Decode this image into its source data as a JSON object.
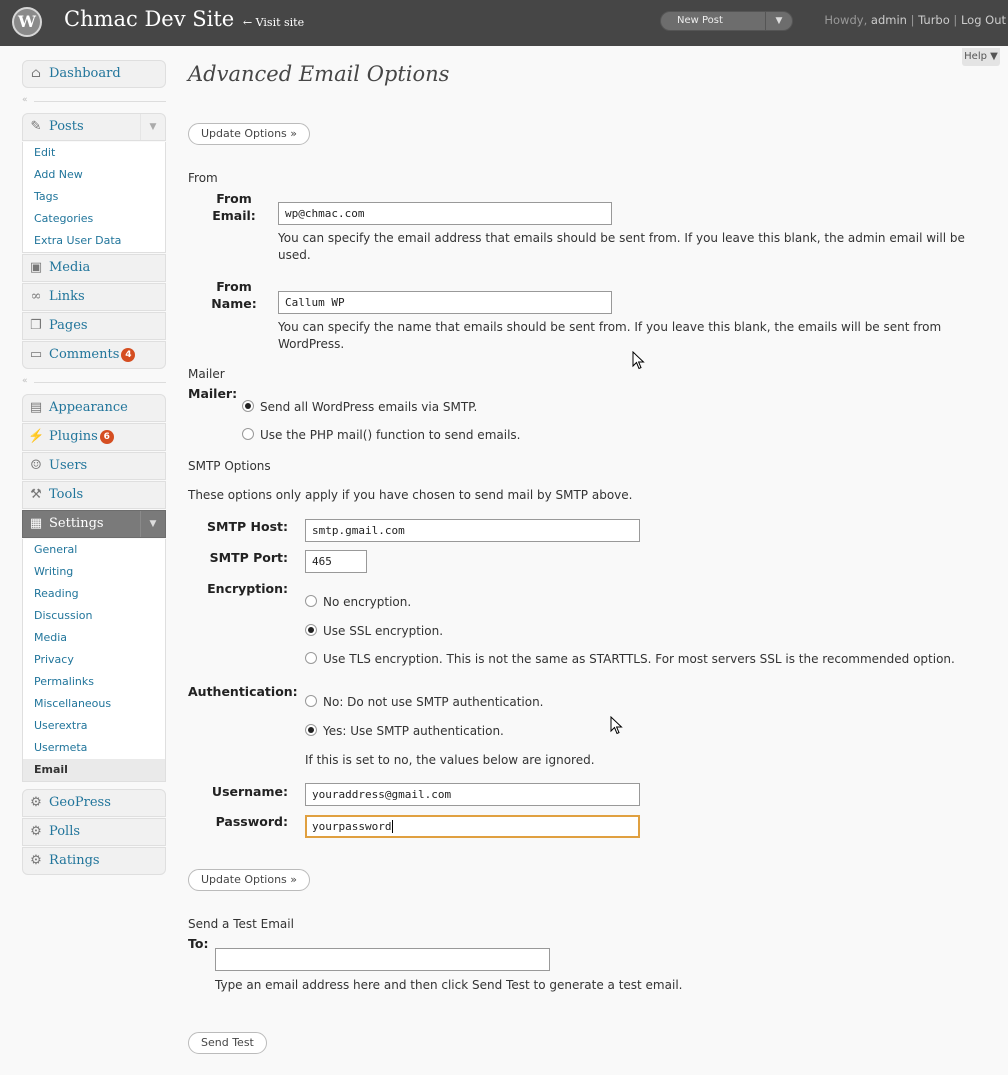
{
  "header": {
    "site_title": "Chmac Dev Site",
    "visit_site": "← Visit site",
    "new_post": "New Post",
    "howdy": "Howdy,",
    "user": "admin",
    "turbo": "Turbo",
    "logout": "Log Out",
    "help": "Help ▼"
  },
  "menu": {
    "dashboard": "Dashboard",
    "posts": "Posts",
    "posts_sub": [
      "Edit",
      "Add New",
      "Tags",
      "Categories",
      "Extra User Data"
    ],
    "media": "Media",
    "links": "Links",
    "pages": "Pages",
    "comments": "Comments",
    "comments_count": "4",
    "appearance": "Appearance",
    "plugins": "Plugins",
    "plugins_count": "6",
    "users": "Users",
    "tools": "Tools",
    "settings": "Settings",
    "settings_sub": [
      "General",
      "Writing",
      "Reading",
      "Discussion",
      "Media",
      "Privacy",
      "Permalinks",
      "Miscellaneous",
      "Userextra",
      "Usermeta",
      "Email"
    ],
    "geopress": "GeoPress",
    "polls": "Polls",
    "ratings": "Ratings"
  },
  "page": {
    "title": "Advanced Email Options",
    "update_button": "Update Options »",
    "from_section": "From",
    "from_email_label": [
      "From",
      "Email:"
    ],
    "from_email_value": "wp@chmac.com",
    "from_email_desc": "You can specify the email address that emails should be sent from. If you leave this blank, the admin email will be used.",
    "from_name_label": [
      "From",
      "Name:"
    ],
    "from_name_value": "Callum WP",
    "from_name_desc": "You can specify the name that emails should be sent from. If you leave this blank, the emails will be sent from WordPress.",
    "mailer_section": "Mailer",
    "mailer_label": "Mailer:",
    "mailer_smtp": "Send all WordPress emails via SMTP.",
    "mailer_php": "Use the PHP mail() function to send emails.",
    "smtp_section": "SMTP Options",
    "smtp_note": "These options only apply if you have chosen to send mail by SMTP above.",
    "smtp_host_label": "SMTP Host:",
    "smtp_host_value": "smtp.gmail.com",
    "smtp_port_label": "SMTP Port:",
    "smtp_port_value": "465",
    "encryption_label": "Encryption:",
    "enc_none": "No encryption.",
    "enc_ssl": "Use SSL encryption.",
    "enc_tls": "Use TLS encryption. This is not the same as STARTTLS. For most servers SSL is the recommended option.",
    "auth_label": "Authentication:",
    "auth_no": "No: Do not use SMTP authentication.",
    "auth_yes": "Yes: Use SMTP authentication.",
    "auth_note": "If this is set to no, the values below are ignored.",
    "username_label": "Username:",
    "username_value": "youraddress@gmail.com",
    "password_label": "Password:",
    "password_value": "yourpassword",
    "test_section": "Send a Test Email",
    "to_label": "To:",
    "to_value": "",
    "to_desc": "Type an email address here and then click Send Test to generate a test email.",
    "send_test_button": "Send Test"
  },
  "state": {
    "mailer": "smtp",
    "encryption": "ssl",
    "authentication": "yes"
  },
  "colors": {
    "header_bg": "#464646",
    "link": "#21759b",
    "badge": "#d54e21",
    "focus_border": "#e0a040"
  }
}
